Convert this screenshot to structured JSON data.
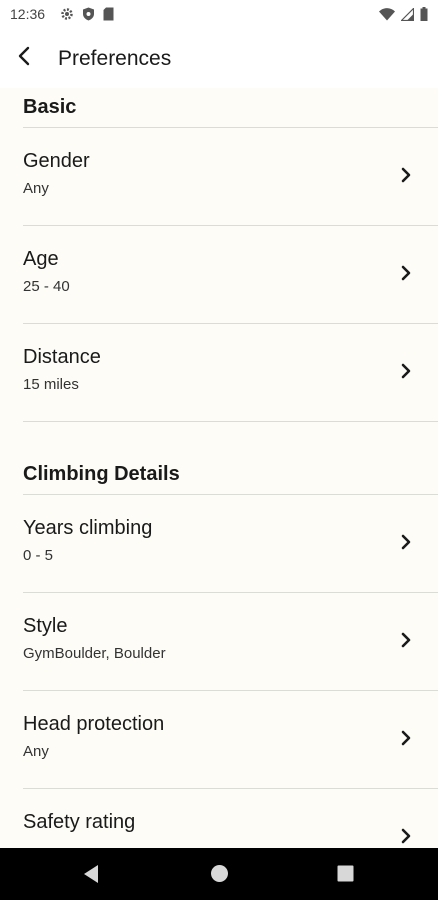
{
  "status_bar": {
    "time": "12:36"
  },
  "app_bar": {
    "title": "Preferences"
  },
  "sections": [
    {
      "header": "Basic",
      "items": [
        {
          "title": "Gender",
          "value": "Any"
        },
        {
          "title": "Age",
          "value": "25 - 40"
        },
        {
          "title": "Distance",
          "value": "15 miles"
        }
      ]
    },
    {
      "header": "Climbing Details",
      "items": [
        {
          "title": "Years climbing",
          "value": "0 - 5"
        },
        {
          "title": "Style",
          "value": "GymBoulder, Boulder"
        },
        {
          "title": "Head protection",
          "value": "Any"
        },
        {
          "title": "Safety rating",
          "value": ""
        }
      ]
    }
  ],
  "icons": {
    "settings": "gear-icon",
    "shield": "shield-icon",
    "sd_card": "sd-card-icon",
    "wifi": "wifi-icon",
    "signal": "signal-icon",
    "battery": "battery-icon",
    "back": "back-arrow-icon",
    "chevron": "chevron-right-icon",
    "nav_back": "nav-back-icon",
    "nav_home": "nav-home-icon",
    "nav_recent": "nav-recent-icon"
  },
  "colors": {
    "background": "#fdfcf6",
    "divider": "#dcdcd6",
    "text": "#1a1a1a",
    "navbar": "#000000"
  }
}
